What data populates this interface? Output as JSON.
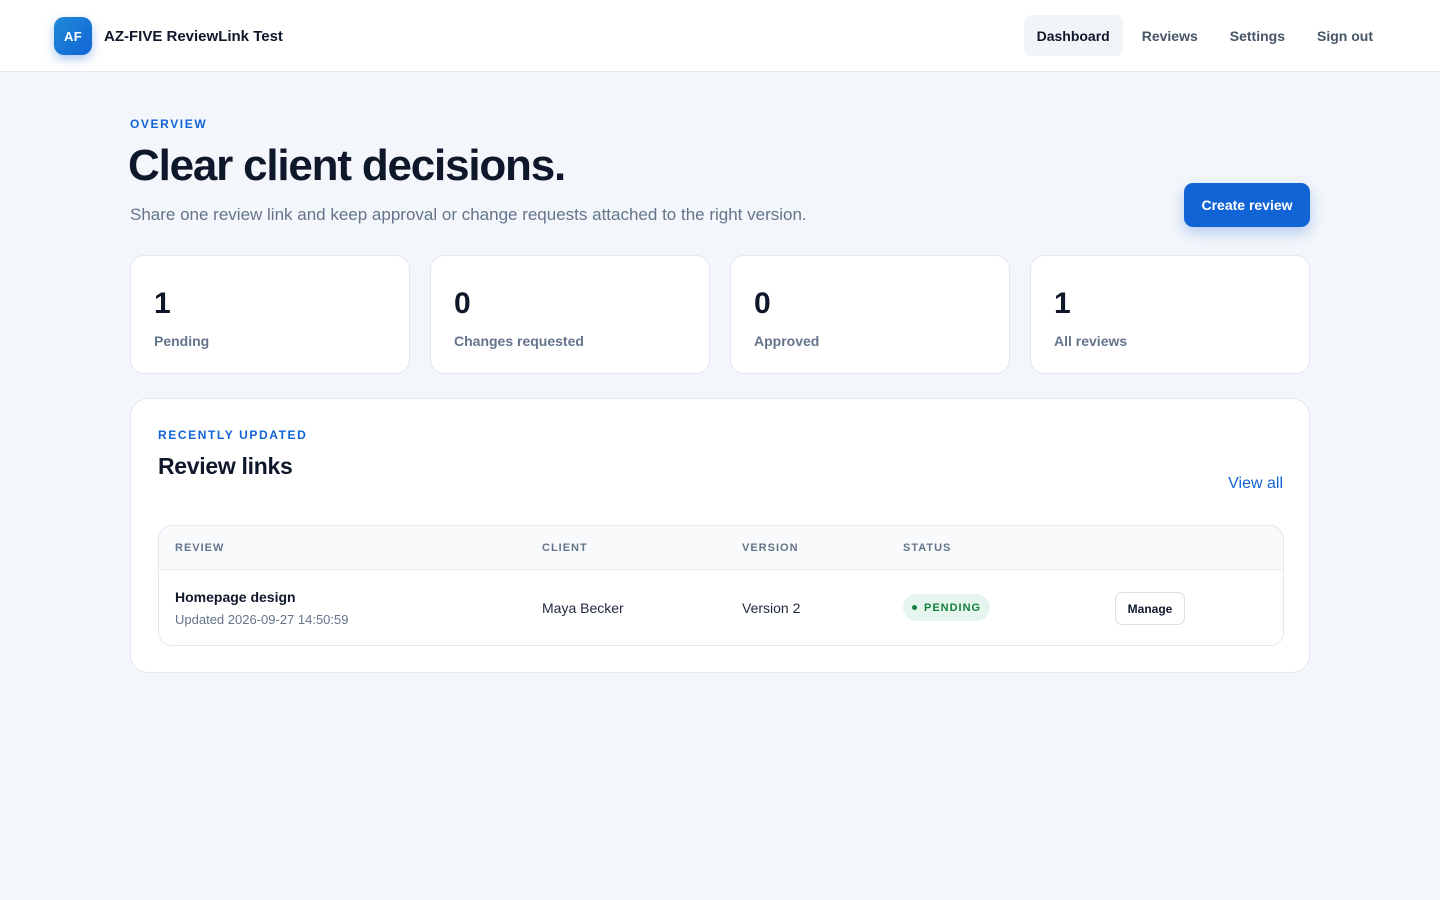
{
  "header": {
    "logo_text": "AF",
    "app_name": "AZ-FIVE ReviewLink Test",
    "nav": [
      {
        "label": "Dashboard",
        "active": true
      },
      {
        "label": "Reviews",
        "active": false
      },
      {
        "label": "Settings",
        "active": false
      },
      {
        "label": "Sign out",
        "active": false
      }
    ]
  },
  "hero": {
    "eyebrow": "OVERVIEW",
    "title": "Clear client decisions.",
    "subtitle": "Share one review link and keep approval or change requests attached to the right version.",
    "create_button": "Create review"
  },
  "stats": [
    {
      "value": "1",
      "label": "Pending"
    },
    {
      "value": "0",
      "label": "Changes requested"
    },
    {
      "value": "0",
      "label": "Approved"
    },
    {
      "value": "1",
      "label": "All reviews"
    }
  ],
  "recent": {
    "eyebrow": "RECENTLY UPDATED",
    "title": "Review links",
    "view_all": "View all",
    "columns": [
      "REVIEW",
      "CLIENT",
      "VERSION",
      "STATUS"
    ],
    "rows": [
      {
        "name": "Homepage design",
        "updated": "Updated 2026-09-27 14:50:59",
        "client": "Maya Becker",
        "version": "Version 2",
        "status": "PENDING",
        "action": "Manage"
      }
    ]
  },
  "colors": {
    "accent": "#1164d6",
    "background": "#f3f6fa",
    "status_pending_bg": "#e6f6ee",
    "status_pending_text": "#15803d"
  }
}
